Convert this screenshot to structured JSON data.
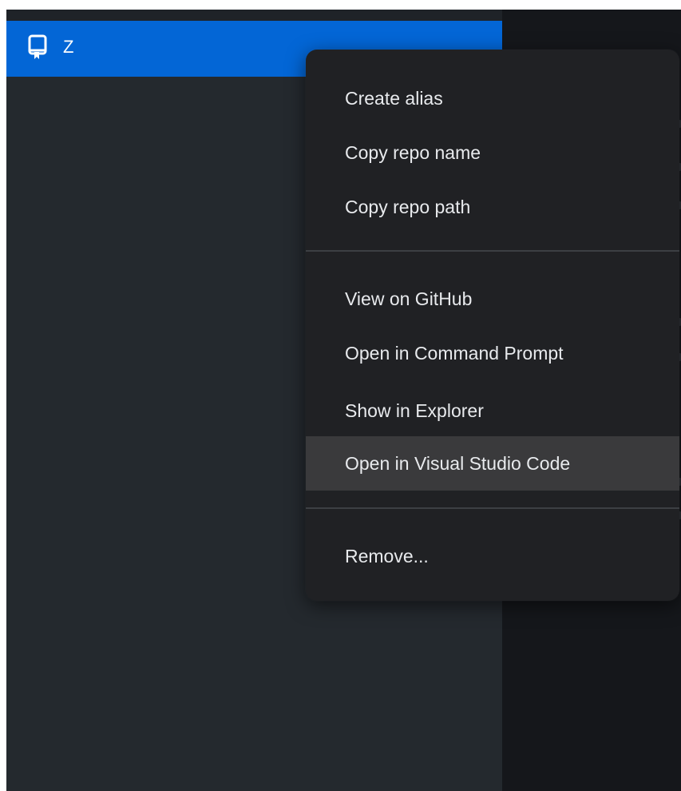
{
  "sidebar": {
    "selected_repo": {
      "name": "Z",
      "icon": "repo-icon"
    }
  },
  "context_menu": {
    "groups": [
      [
        {
          "label": "Create alias"
        },
        {
          "label": "Copy repo name"
        },
        {
          "label": "Copy repo path"
        }
      ],
      [
        {
          "label": "View on GitHub"
        },
        {
          "label": "Open in Command Prompt"
        },
        {
          "label": "Show in Explorer"
        },
        {
          "label": "Open in Visual Studio Code",
          "highlighted": true
        }
      ],
      [
        {
          "label": "Remove..."
        }
      ]
    ]
  },
  "colors": {
    "selection_blue": "#0366d6",
    "sidebar_bg": "#24292e",
    "menu_bg": "#202124",
    "menu_hover": "#3a3a3c",
    "text": "#e8eaed"
  }
}
